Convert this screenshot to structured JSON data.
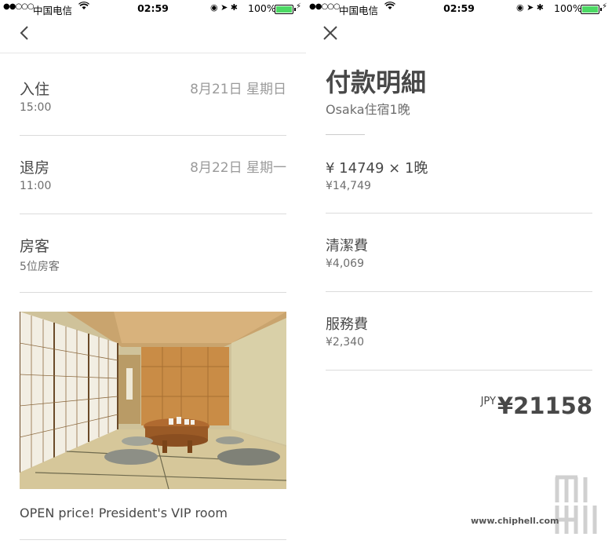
{
  "status_bar": {
    "signal": "●●○○○",
    "carrier": "中国电信",
    "time": "02:59",
    "battery_pct": "100%",
    "battery_color": "#4cd964"
  },
  "left": {
    "nav_icon": "chevron-left-icon",
    "checkin": {
      "label": "入住",
      "time": "15:00",
      "date": "8月21日 星期日"
    },
    "checkout": {
      "label": "退房",
      "time": "11:00",
      "date": "8月22日 星期一"
    },
    "guests": {
      "label": "房客",
      "value": "5位房客"
    },
    "listing_caption": "OPEN price! President's VIP room"
  },
  "right": {
    "nav_icon": "close-icon",
    "title": "付款明細",
    "subtitle": "Osaka住宿1晚",
    "items": [
      {
        "label": "¥ 14749 × 1晚",
        "amount": "¥14,749"
      },
      {
        "label": "清潔費",
        "amount": "¥4,069"
      },
      {
        "label": "服務費",
        "amount": "¥2,340"
      }
    ],
    "total": {
      "currency": "JPY",
      "amount": "¥21158"
    }
  },
  "watermark": {
    "brand": "chiphell",
    "url": "www.chiphell.com"
  }
}
